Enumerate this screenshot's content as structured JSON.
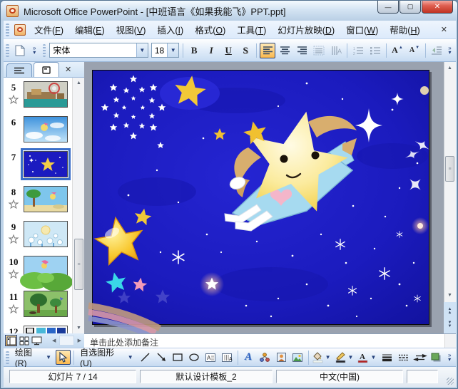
{
  "window": {
    "title": "Microsoft Office PowerPoint - [中班语言《如果我能飞》PPT.ppt]",
    "controls": {
      "minimize": "—",
      "maximize": "▢",
      "close": "✕"
    }
  },
  "menu_bar": {
    "items": [
      {
        "pre": "文件(",
        "key": "F",
        "post": ")"
      },
      {
        "pre": "编辑(",
        "key": "E",
        "post": ")"
      },
      {
        "pre": "视图(",
        "key": "V",
        "post": ")"
      },
      {
        "pre": "插入(",
        "key": "I",
        "post": ")"
      },
      {
        "pre": "格式(",
        "key": "O",
        "post": ")"
      },
      {
        "pre": "工具(",
        "key": "T",
        "post": ")"
      },
      {
        "pre": "幻灯片放映(",
        "key": "D",
        "post": ")"
      },
      {
        "pre": "窗口(",
        "key": "W",
        "post": ")"
      },
      {
        "pre": "帮助(",
        "key": "H",
        "post": ")"
      }
    ],
    "close": "✕"
  },
  "format_toolbar": {
    "font_name": "宋体",
    "font_size": "18",
    "bold": "B",
    "italic": "I",
    "underline": "U",
    "shadow": "S",
    "grow_font": "A",
    "shrink_font": "A"
  },
  "slides_panel": {
    "slides": [
      {
        "number": "5"
      },
      {
        "number": "6"
      },
      {
        "number": "7"
      },
      {
        "number": "8"
      },
      {
        "number": "9"
      },
      {
        "number": "10"
      },
      {
        "number": "11"
      },
      {
        "number": "12"
      }
    ],
    "selected_number": "7"
  },
  "notes": {
    "placeholder": "单击此处添加备注"
  },
  "drawing_toolbar": {
    "draw": {
      "pre": "绘图(",
      "key": "R",
      "post": ")"
    },
    "autoshapes": {
      "pre": "自选图形(",
      "key": "U",
      "post": ")"
    }
  },
  "status_bar": {
    "slide_indicator": "幻灯片 7 / 14",
    "design_template": "默认设计模板_2",
    "language": "中文(中国)"
  },
  "colors": {
    "selection_highlight": "#fbb84d",
    "slide_background": "#1b1bc0",
    "selected_thumb_border": "#3a6ec8"
  }
}
